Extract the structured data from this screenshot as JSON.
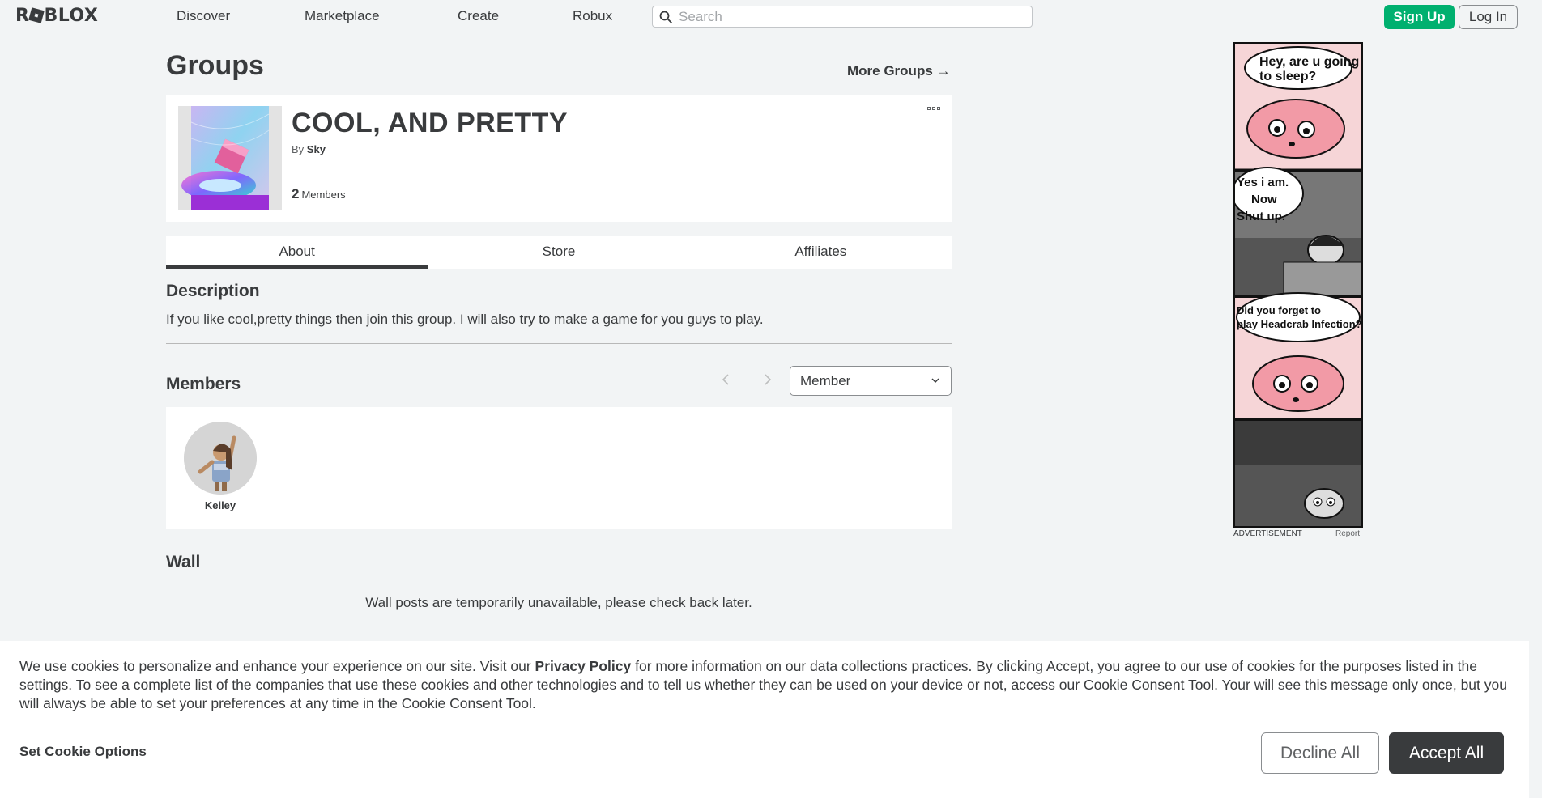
{
  "nav": {
    "logo": "ROBLOX",
    "logo_parts": [
      "R",
      "BLOX"
    ],
    "links": [
      "Discover",
      "Marketplace",
      "Create",
      "Robux"
    ],
    "search_placeholder": "Search",
    "signup_label": "Sign Up",
    "login_label": "Log In"
  },
  "page": {
    "heading": "Groups",
    "more_groups": "More Groups →"
  },
  "group": {
    "name": "COOL, AND PRETTY",
    "by_prefix": "By",
    "owner": "Sky",
    "member_count": "2",
    "member_label": "Members"
  },
  "tabs": [
    "About",
    "Store",
    "Affiliates"
  ],
  "description": {
    "title": "Description",
    "text": "If you like cool,pretty things then join this group. I will also try to make a game for you guys to play."
  },
  "members": {
    "title": "Members",
    "role_selected": "Member",
    "list": [
      {
        "name": "Keiley"
      }
    ]
  },
  "wall": {
    "title": "Wall",
    "message": "Wall posts are temporarily unavailable, please check back later."
  },
  "ad": {
    "label": "ADVERTISEMENT",
    "report": "Report",
    "panel1_text": "Hey, are u going to sleep?",
    "panel2_text": "Yes i am. Now Shut up.",
    "panel3_text": "Did you forget to play Headcrab Infection?"
  },
  "cookie": {
    "text_before": "We use cookies to personalize and enhance your experience on our site. Visit our ",
    "privacy_link": "Privacy Policy",
    "text_after": " for more information on our data collections practices. By clicking Accept, you agree to our use of cookies for the purposes listed in the settings. To see a complete list of the companies that use these cookies and other technologies and to tell us whether they can be used on your device or not, access our Cookie Consent Tool. Your will see this message only once, but you will always be able to set your preferences at any time in the Cookie Consent Tool.",
    "settings_label": "Set Cookie Options",
    "decline_label": "Decline All",
    "accept_label": "Accept All"
  },
  "colors": {
    "background": "#f2f4f5",
    "text": "#393b3d",
    "signup_green": "#00b06f",
    "accept_dark": "#393b3d"
  }
}
